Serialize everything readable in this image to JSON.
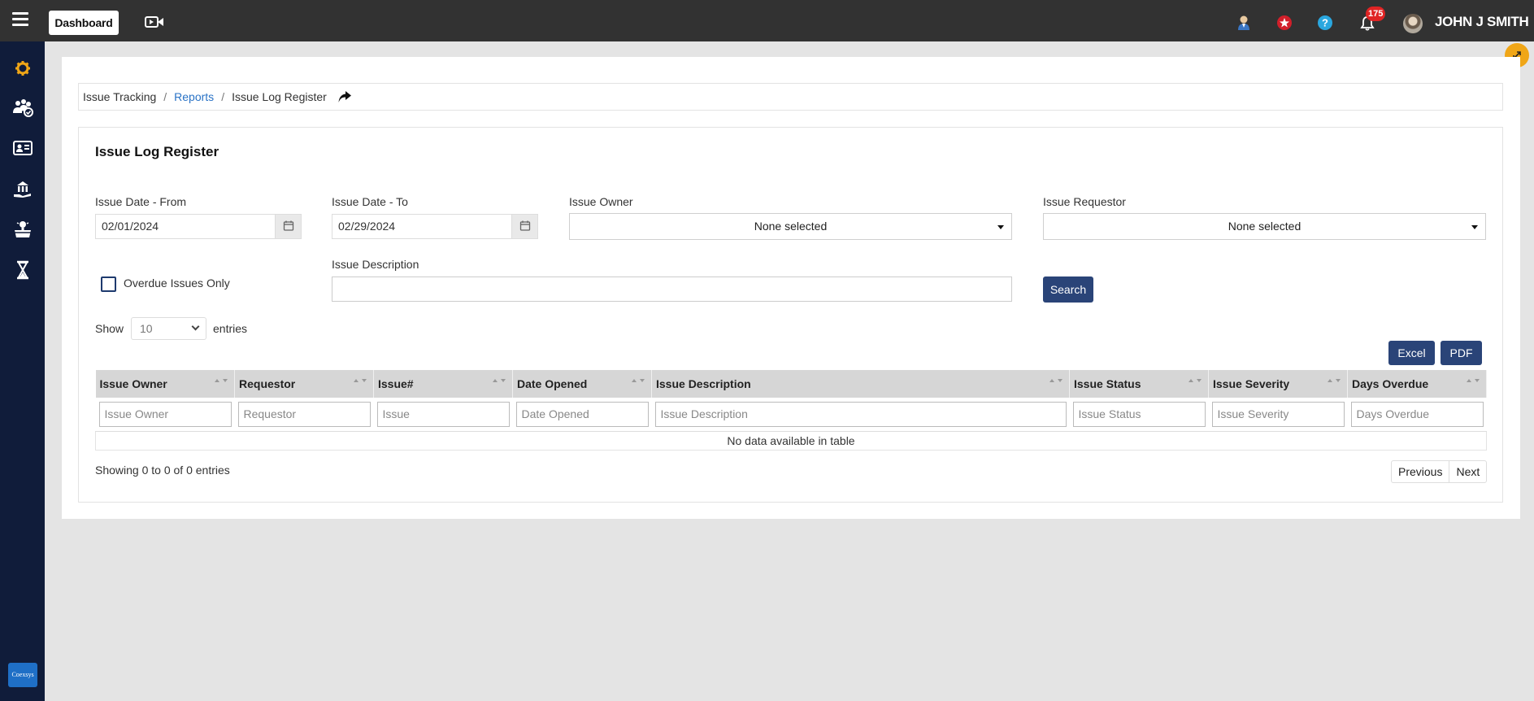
{
  "topbar": {
    "dashboard_label": "Dashboard",
    "notification_count": "175",
    "user_name": "JOHN J SMITH",
    "icons": [
      "menu-icon",
      "video-icon",
      "user-profile-icon",
      "favorites-icon",
      "help-icon",
      "bell-icon"
    ]
  },
  "sidebar": {
    "icons": [
      "settings-icon",
      "users-icon",
      "id-card-icon",
      "building-hand-icon",
      "ideas-box-icon",
      "hourglass-icon"
    ],
    "logo_text": "Coexsys",
    "accent_color": "#f0a617"
  },
  "breadcrumb": {
    "root": "Issue Tracking",
    "sep1": "/",
    "reports": "Reports",
    "sep2": "/",
    "current": "Issue Log Register"
  },
  "form": {
    "title": "Issue Log Register",
    "date_from_label": "Issue Date - From",
    "date_from_value": "02/01/2024",
    "date_to_label": "Issue Date - To",
    "date_to_value": "02/29/2024",
    "owner_label": "Issue Owner",
    "owner_value": "None selected",
    "requestor_label": "Issue Requestor",
    "requestor_value": "None selected",
    "overdue_label": "Overdue Issues Only",
    "overdue_checked": false,
    "description_label": "Issue Description",
    "description_value": "",
    "search_label": "Search"
  },
  "table_controls": {
    "show_label": "Show",
    "page_length": "10",
    "entries_label": "entries",
    "excel_label": "Excel",
    "pdf_label": "PDF"
  },
  "table": {
    "columns": [
      {
        "header": "Issue Owner",
        "filter_placeholder": "Issue Owner"
      },
      {
        "header": "Requestor",
        "filter_placeholder": "Requestor"
      },
      {
        "header": "Issue#",
        "filter_placeholder": "Issue"
      },
      {
        "header": "Date Opened",
        "filter_placeholder": "Date Opened"
      },
      {
        "header": "Issue Description",
        "filter_placeholder": "Issue Description"
      },
      {
        "header": "Issue Status",
        "filter_placeholder": "Issue Status"
      },
      {
        "header": "Issue Severity",
        "filter_placeholder": "Issue Severity"
      },
      {
        "header": "Days Overdue",
        "filter_placeholder": "Days Overdue"
      }
    ],
    "empty_message": "No data available in table",
    "info": "Showing 0 to 0 of 0 entries",
    "previous_label": "Previous",
    "next_label": "Next"
  }
}
